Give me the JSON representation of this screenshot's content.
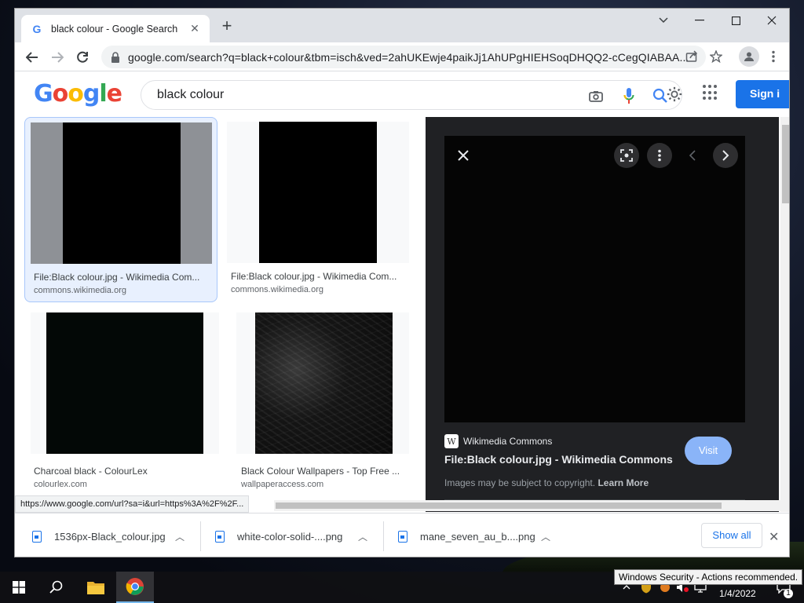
{
  "browser": {
    "tab_title": "black colour - Google Search",
    "url": "google.com/search?q=black+colour&tbm=isch&ved=2ahUKEwje4paikJj1AhUPgHIEHSoqDHQQ2-cCegQIABAA..."
  },
  "google": {
    "logo_letters": [
      {
        "ch": "G",
        "color": "#4285f4"
      },
      {
        "ch": "o",
        "color": "#ea4335"
      },
      {
        "ch": "o",
        "color": "#fbbc05"
      },
      {
        "ch": "g",
        "color": "#4285f4"
      },
      {
        "ch": "l",
        "color": "#34a853"
      },
      {
        "ch": "e",
        "color": "#ea4335"
      }
    ],
    "query": "black colour",
    "signin_label": "Sign i"
  },
  "results": [
    {
      "title": "File:Black colour.jpg - Wikimedia Com...",
      "source": "commons.wikimedia.org",
      "selected": true
    },
    {
      "title": "File:Black colour.jpg - Wikimedia Com...",
      "source": "commons.wikimedia.org",
      "selected": false
    },
    {
      "title": "Charcoal black - ColourLex",
      "source": "colourlex.com",
      "selected": false
    },
    {
      "title": "Black Colour Wallpapers - Top Free ...",
      "source": "wallpaperaccess.com",
      "selected": false
    }
  ],
  "preview": {
    "source_name": "Wikimedia Commons",
    "title": "File:Black colour.jpg - Wikimedia Commons",
    "visit_label": "Visit",
    "copyright_text": "Images may be subject to copyright.",
    "learn_more": "Learn More"
  },
  "status_url": "https://www.google.com/url?sa=i&url=https%3A%2F%2F...",
  "downloads": {
    "items": [
      {
        "name": "1536px-Black_colour.jpg"
      },
      {
        "name": "white-color-solid-....png"
      },
      {
        "name": "mane_seven_au_b....png"
      }
    ],
    "show_all": "Show all"
  },
  "taskbar": {
    "date": "1/4/2022",
    "notification_count": "1",
    "tooltip": "Windows Security - Actions recommended."
  },
  "colors": {
    "google_blue": "#1a73e8",
    "selected_tile_bg": "#e8f0fe",
    "preview_bg": "#202124"
  }
}
